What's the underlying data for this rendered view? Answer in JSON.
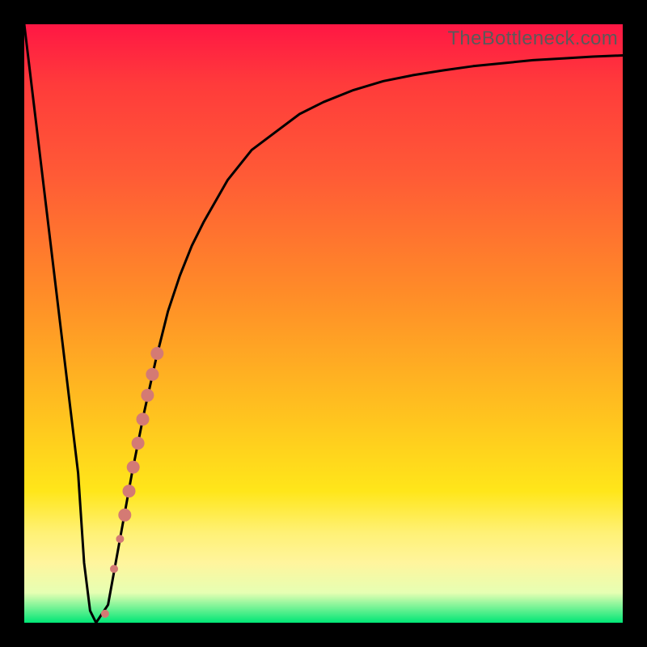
{
  "watermark": "TheBottleneck.com",
  "chart_data": {
    "type": "line",
    "title": "",
    "xlabel": "",
    "ylabel": "",
    "xlim": [
      0,
      100
    ],
    "ylim": [
      0,
      100
    ],
    "grid": false,
    "series": [
      {
        "name": "bottleneck-curve",
        "x": [
          0,
          3,
          6,
          9,
          10,
          11,
          12,
          14,
          16,
          18,
          20,
          22,
          24,
          26,
          28,
          30,
          34,
          38,
          42,
          46,
          50,
          55,
          60,
          65,
          70,
          75,
          80,
          85,
          90,
          95,
          100
        ],
        "y": [
          100,
          75,
          50,
          25,
          10,
          2,
          0,
          3,
          14,
          25,
          35,
          44,
          52,
          58,
          63,
          67,
          74,
          79,
          82,
          85,
          87,
          89,
          90.5,
          91.5,
          92.3,
          93,
          93.5,
          94,
          94.3,
          94.6,
          94.8
        ],
        "min_x": 12,
        "min_y": 0
      }
    ],
    "markers": [
      {
        "name": "highlight-dots",
        "color": "#d47a74",
        "points": [
          {
            "x": 13.5,
            "y": 1.5,
            "r": 5
          },
          {
            "x": 15.0,
            "y": 9.0,
            "r": 5
          },
          {
            "x": 16.0,
            "y": 14.0,
            "r": 5
          },
          {
            "x": 16.8,
            "y": 18.0,
            "r": 8
          },
          {
            "x": 17.5,
            "y": 22.0,
            "r": 8
          },
          {
            "x": 18.2,
            "y": 26.0,
            "r": 8
          },
          {
            "x": 19.0,
            "y": 30.0,
            "r": 8
          },
          {
            "x": 19.8,
            "y": 34.0,
            "r": 8
          },
          {
            "x": 20.6,
            "y": 38.0,
            "r": 8
          },
          {
            "x": 21.4,
            "y": 41.5,
            "r": 8
          },
          {
            "x": 22.2,
            "y": 45.0,
            "r": 8
          }
        ]
      }
    ]
  }
}
